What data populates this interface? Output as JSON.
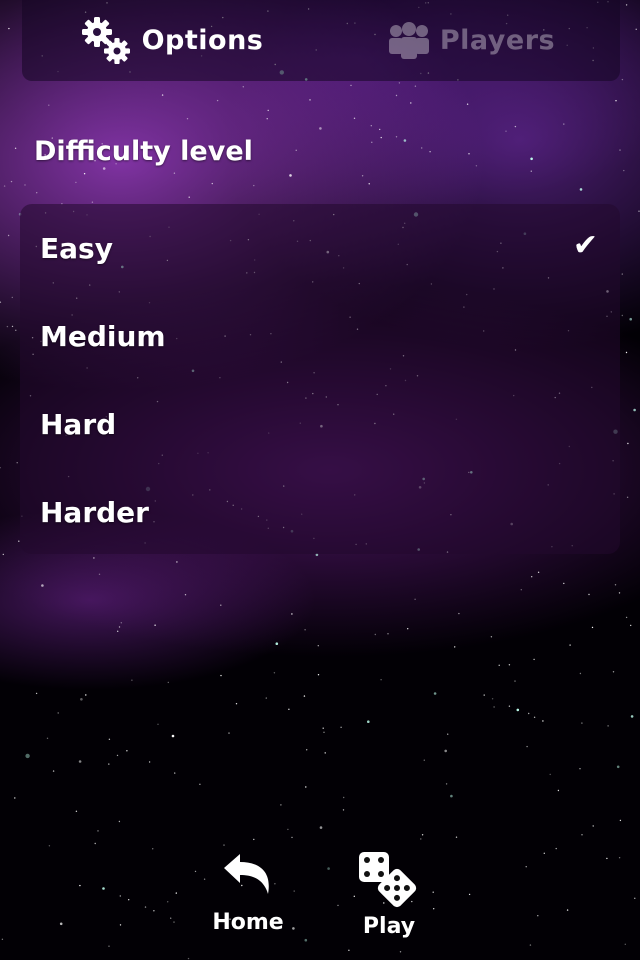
{
  "tabs": [
    {
      "label": "Options",
      "icon": "gears-icon",
      "active": true
    },
    {
      "label": "Players",
      "icon": "players-icon",
      "active": false
    }
  ],
  "section": {
    "title": "Difficulty level"
  },
  "difficulty": {
    "items": [
      {
        "label": "Easy",
        "selected": true
      },
      {
        "label": "Medium",
        "selected": false
      },
      {
        "label": "Hard",
        "selected": false
      },
      {
        "label": "Harder",
        "selected": false
      }
    ],
    "check_glyph": "✔"
  },
  "bottom": {
    "home_label": "Home",
    "play_label": "Play"
  },
  "colors": {
    "text": "#ffffff",
    "nebula": "#9b3cbe",
    "panel": "#230a2d"
  }
}
